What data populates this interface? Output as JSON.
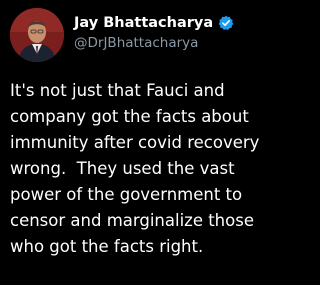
{
  "author": {
    "display_name": "Jay Bhattacharya",
    "handle": "@DrJBhattacharya",
    "verified": true,
    "avatar_icon": "profile-photo",
    "verified_icon": "verified-badge-icon"
  },
  "tweet": {
    "lines": [
      "It's not just that Fauci and",
      "company got the facts about",
      "immunity after covid recovery",
      "wrong.  They used the vast",
      "power of the government to",
      "censor and marginalize those",
      "who got the facts right."
    ]
  },
  "colors": {
    "background": "#000000",
    "name": "#ffffff",
    "handle": "#8b98a5",
    "verified_badge": "#1d9bf0",
    "avatar_bg": "#7a1e1e"
  }
}
